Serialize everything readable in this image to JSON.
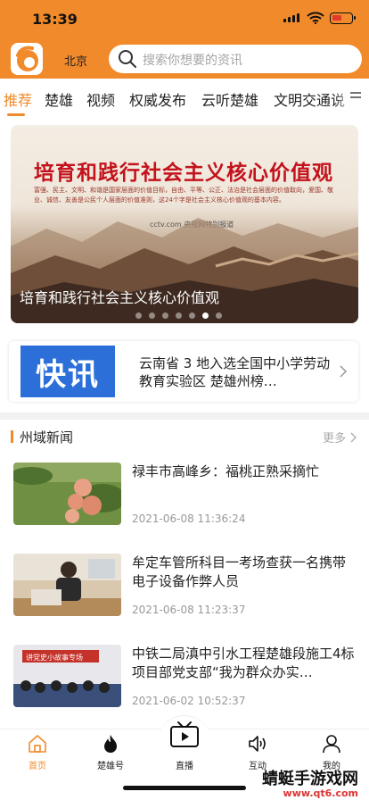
{
  "status_bar": {
    "time": "13:39"
  },
  "header": {
    "city": "北京",
    "search_placeholder": "搜索你想要的资讯"
  },
  "tabs": [
    {
      "label": "推荐",
      "active": true
    },
    {
      "label": "楚雄"
    },
    {
      "label": "视频"
    },
    {
      "label": "权威发布"
    },
    {
      "label": "云听楚雄"
    },
    {
      "label": "文明交通说"
    }
  ],
  "banner": {
    "title": "培育和践行社会主义核心价值观",
    "body": "富强、民主、文明、和谐是国家层面的价值目标，自由、平等、公正、法治是社会层面的价值取向，爱国、敬业、诚信、友善是公民个人层面的价值准则，这24个字是社会主义核心价值观的基本内容。",
    "brand": "cctv.com 央视网特别报道",
    "caption": "培育和践行社会主义核心价值观",
    "slide_count": 7,
    "active_slide": 5
  },
  "flash": {
    "badge": "快讯",
    "text": "云南省 3 地入选全国中小学劳动教育实验区  楚雄州榜…"
  },
  "section": {
    "title": "州域新闻",
    "more": "更多"
  },
  "news": [
    {
      "title": "禄丰市高峰乡：福桃正熟采摘忙",
      "time": "2021-06-08 11:36:24"
    },
    {
      "title": "牟定车管所科目一考场查获一名携带电子设备作弊人员",
      "time": "2021-06-08 11:23:37"
    },
    {
      "title": "中铁二局滇中引水工程楚雄段施工4标项目部党支部“我为群众办实…",
      "time": "2021-06-02 10:52:37",
      "thumb_text": "讲党史小故事专场"
    }
  ],
  "bottom_nav": [
    {
      "label": "首页",
      "icon": "home-icon",
      "active": true
    },
    {
      "label": "楚雄号",
      "icon": "flame-icon"
    },
    {
      "label": "直播",
      "icon": "tv-play-icon"
    },
    {
      "label": "互动",
      "icon": "speaker-icon"
    },
    {
      "label": "我的",
      "icon": "person-icon"
    }
  ],
  "watermark": {
    "name": "蜻蜓手游戏网",
    "url": "www.qt6.com"
  },
  "colors": {
    "accent": "#f08a2a",
    "flash_blue": "#2c6fd8",
    "banner_red": "#c3121b"
  }
}
